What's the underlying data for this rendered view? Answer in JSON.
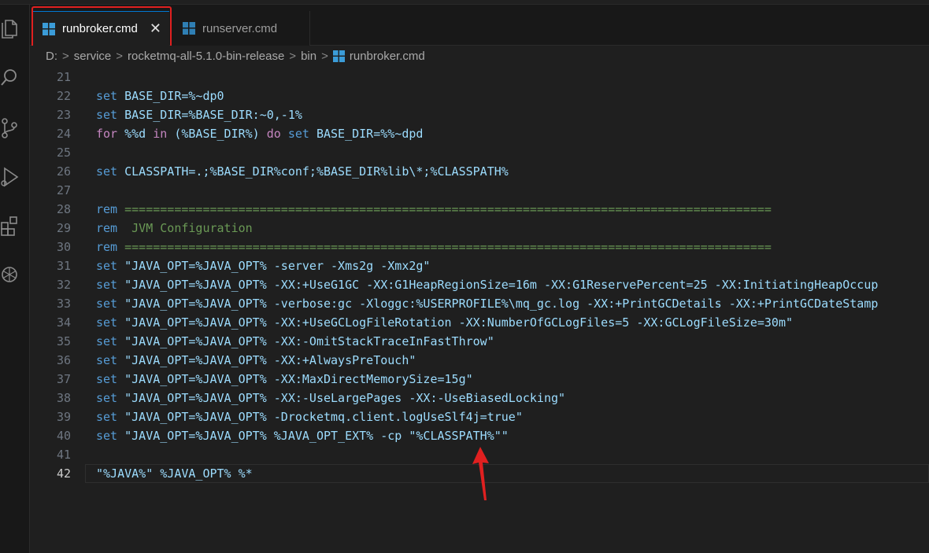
{
  "tabs": [
    {
      "label": "runbroker.cmd",
      "active": true,
      "close": "✕"
    },
    {
      "label": "runserver.cmd",
      "active": false
    }
  ],
  "breadcrumb": [
    "D:",
    "service",
    "rocketmq-all-5.1.0-bin-release",
    "bin",
    "runbroker.cmd"
  ],
  "breadcrumb_separator": ">",
  "colors": {
    "keyword": "#569cd6",
    "control": "#c586c0",
    "string": "#ce9178",
    "comment": "#6a9955",
    "annotation": "#e02020"
  },
  "activity_icons": [
    "files-icon",
    "search-icon",
    "source-control-icon",
    "run-debug-icon",
    "extensions-icon",
    "openai-icon"
  ],
  "code_lines": [
    {
      "n": "21",
      "tokens": []
    },
    {
      "n": "22",
      "tokens": [
        {
          "t": "set",
          "c": "kw"
        },
        {
          "t": " BASE_DIR=%~dp0",
          "c": "var"
        }
      ]
    },
    {
      "n": "23",
      "tokens": [
        {
          "t": "set",
          "c": "kw"
        },
        {
          "t": " BASE_DIR=%BASE_DIR:~0,-1%",
          "c": "var"
        }
      ]
    },
    {
      "n": "24",
      "tokens": [
        {
          "t": "for",
          "c": "ctl"
        },
        {
          "t": " %%d ",
          "c": "var"
        },
        {
          "t": "in",
          "c": "ctl"
        },
        {
          "t": " (%BASE_DIR%) ",
          "c": "var"
        },
        {
          "t": "do",
          "c": "ctl"
        },
        {
          "t": " ",
          "c": "plain"
        },
        {
          "t": "set",
          "c": "kw"
        },
        {
          "t": " BASE_DIR=%%~dpd",
          "c": "var"
        }
      ]
    },
    {
      "n": "25",
      "tokens": []
    },
    {
      "n": "26",
      "tokens": [
        {
          "t": "set",
          "c": "kw"
        },
        {
          "t": " CLASSPATH=.;%BASE_DIR%conf;%BASE_DIR%lib\\*;%CLASSPATH%",
          "c": "var"
        }
      ]
    },
    {
      "n": "27",
      "tokens": []
    },
    {
      "n": "28",
      "tokens": [
        {
          "t": "rem",
          "c": "kw"
        },
        {
          "t": " ===========================================================================================",
          "c": "cmt"
        }
      ]
    },
    {
      "n": "29",
      "tokens": [
        {
          "t": "rem",
          "c": "kw"
        },
        {
          "t": "  JVM Configuration",
          "c": "cmt"
        }
      ]
    },
    {
      "n": "30",
      "tokens": [
        {
          "t": "rem",
          "c": "kw"
        },
        {
          "t": " ===========================================================================================",
          "c": "cmt"
        }
      ]
    },
    {
      "n": "31",
      "tokens": [
        {
          "t": "set",
          "c": "kw"
        },
        {
          "t": " \"JAVA_OPT=%JAVA_OPT% -server -Xms2g -Xmx2g\"",
          "c": "var"
        }
      ]
    },
    {
      "n": "32",
      "tokens": [
        {
          "t": "set",
          "c": "kw"
        },
        {
          "t": " \"JAVA_OPT=%JAVA_OPT% -XX:+UseG1GC -XX:G1HeapRegionSize=16m -XX:G1ReservePercent=25 -XX:InitiatingHeapOccup",
          "c": "var"
        }
      ]
    },
    {
      "n": "33",
      "tokens": [
        {
          "t": "set",
          "c": "kw"
        },
        {
          "t": " \"JAVA_OPT=%JAVA_OPT% -verbose:gc -Xloggc:%USERPROFILE%\\mq_gc.log -XX:+PrintGCDetails -XX:+PrintGCDateStamp",
          "c": "var"
        }
      ]
    },
    {
      "n": "34",
      "tokens": [
        {
          "t": "set",
          "c": "kw"
        },
        {
          "t": " \"JAVA_OPT=%JAVA_OPT% -XX:+UseGCLogFileRotation -XX:NumberOfGCLogFiles=5 -XX:GCLogFileSize=30m\"",
          "c": "var"
        }
      ]
    },
    {
      "n": "35",
      "tokens": [
        {
          "t": "set",
          "c": "kw"
        },
        {
          "t": " \"JAVA_OPT=%JAVA_OPT% -XX:-OmitStackTraceInFastThrow\"",
          "c": "var"
        }
      ]
    },
    {
      "n": "36",
      "tokens": [
        {
          "t": "set",
          "c": "kw"
        },
        {
          "t": " \"JAVA_OPT=%JAVA_OPT% -XX:+AlwaysPreTouch\"",
          "c": "var"
        }
      ]
    },
    {
      "n": "37",
      "tokens": [
        {
          "t": "set",
          "c": "kw"
        },
        {
          "t": " \"JAVA_OPT=%JAVA_OPT% -XX:MaxDirectMemorySize=15g\"",
          "c": "var"
        }
      ]
    },
    {
      "n": "38",
      "tokens": [
        {
          "t": "set",
          "c": "kw"
        },
        {
          "t": " \"JAVA_OPT=%JAVA_OPT% -XX:-UseLargePages -XX:-UseBiasedLocking\"",
          "c": "var"
        }
      ]
    },
    {
      "n": "39",
      "tokens": [
        {
          "t": "set",
          "c": "kw"
        },
        {
          "t": " \"JAVA_OPT=%JAVA_OPT% -Drocketmq.client.logUseSlf4j=true\"",
          "c": "var"
        }
      ]
    },
    {
      "n": "40",
      "tokens": [
        {
          "t": "set",
          "c": "kw"
        },
        {
          "t": " \"JAVA_OPT=%JAVA_OPT% %JAVA_OPT_EXT% -cp \"%CLASSPATH%\"\"",
          "c": "var"
        }
      ]
    },
    {
      "n": "41",
      "tokens": []
    },
    {
      "n": "42",
      "tokens": [
        {
          "t": "\"%JAVA%\" %JAVA_OPT% %*",
          "c": "var"
        }
      ],
      "current": true
    }
  ]
}
